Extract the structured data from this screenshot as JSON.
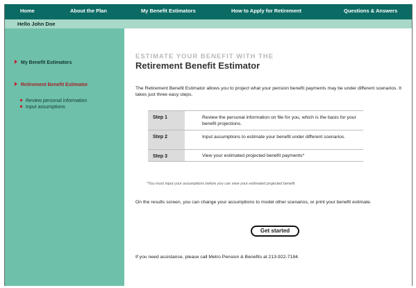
{
  "nav": {
    "items": [
      "Home",
      "About the Plan",
      "My Benefit Estimators",
      "How to Apply for Retirement",
      "Questions & Answers"
    ]
  },
  "greeting": "Hello John Doe",
  "sidebar": {
    "section1": "My Benefit Estimators",
    "section2": "Retirement Benefit Estimator",
    "subitems": [
      "Review personal information",
      "Input assumptions"
    ]
  },
  "main": {
    "eyebrow": "ESTIMATE YOUR BENEFIT WITH THE",
    "title": "Retirement Benefit Estimator",
    "intro": "The Retirement Benefit Estimator allows you to project what your pension benefit payments may be under different scenarios. It takes just three easy steps.",
    "steps": [
      {
        "label": "Step 1",
        "text": "Review the personal information on file for you, which is the basis for your benefit projections."
      },
      {
        "label": "Step 2",
        "text": "Input assumptions to estimate your benefit under different scenarios."
      },
      {
        "label": "Step 3",
        "text": "View your estimated projected benefit payments*"
      }
    ],
    "footnote": "*You must input your assumptions before you can view your estimated projected benefit",
    "results": "On the results screen, you can change your assumptions to model other scenarios, or print your benefit estimate.",
    "button_label": "Get started",
    "assistance": "If you need assistance, please call Metro Pension & Benefits at 213-922-7184."
  }
}
